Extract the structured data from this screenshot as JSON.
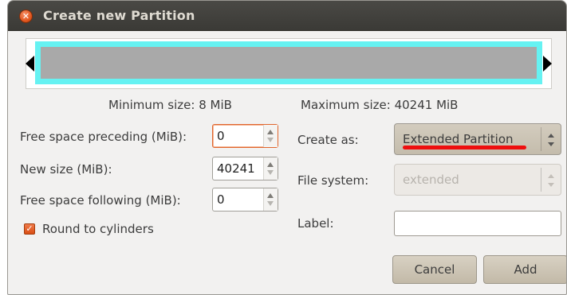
{
  "window": {
    "title": "Create new Partition",
    "close_icon": "✕"
  },
  "sizes": {
    "minimum_label": "Minimum size: 8 MiB",
    "maximum_label": "Maximum size: 40241 MiB"
  },
  "fields": {
    "free_preceding": {
      "label": "Free space preceding (MiB):",
      "value": "0"
    },
    "new_size": {
      "label": "New size (MiB):",
      "value": "40241"
    },
    "free_following": {
      "label": "Free space following (MiB):",
      "value": "0"
    },
    "round_cylinders": {
      "label": "Round to cylinders",
      "checked": true
    }
  },
  "create_as": {
    "label": "Create as:",
    "value": "Extended Partition"
  },
  "file_system": {
    "label": "File system:",
    "value": "extended"
  },
  "label_field": {
    "label": "Label:",
    "value": ""
  },
  "buttons": {
    "cancel": "Cancel",
    "add": "Add"
  },
  "colors": {
    "partition_border": "#66f2f2",
    "partition_fill": "#a9a9a9",
    "annotation_underline": "#ee0e0e",
    "checkbox_accent": "#e0662e"
  }
}
